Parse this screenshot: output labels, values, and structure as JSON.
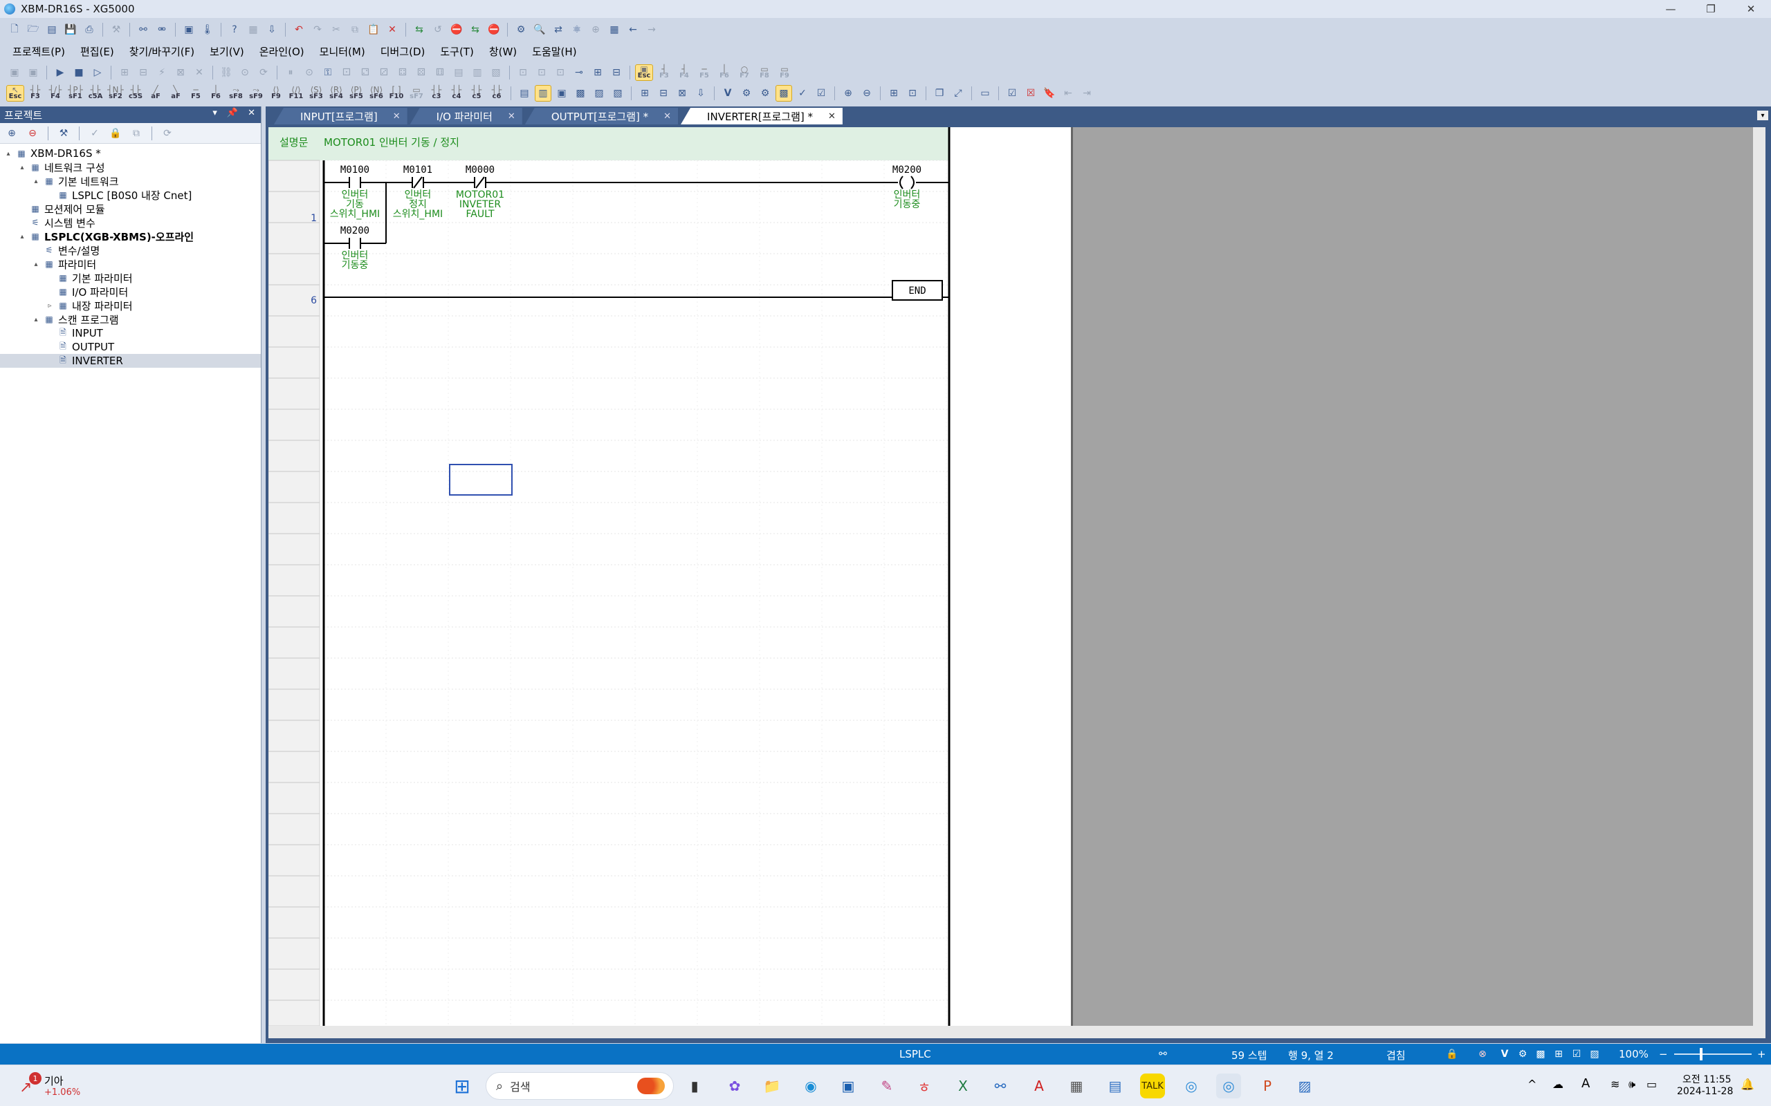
{
  "window": {
    "title": "XBM-DR16S - XG5000"
  },
  "menu": [
    "프로젝트(P)",
    "편집(E)",
    "찾기/바꾸기(F)",
    "보기(V)",
    "온라인(O)",
    "모니터(M)",
    "디버그(D)",
    "도구(T)",
    "창(W)",
    "도움말(H)"
  ],
  "fkeys": [
    "Esc",
    "F3",
    "F4",
    "sF1",
    "c5A",
    "sF2",
    "c5S",
    "aF",
    "aF",
    "F5",
    "F6",
    "sF8",
    "sF9",
    "F9",
    "F11",
    "sF3",
    "sF4",
    "sF5",
    "sF6",
    "F10",
    "sF7",
    "c3",
    "c4",
    "c5",
    "c6"
  ],
  "fkeys2": [
    "F3",
    "F4",
    "F5",
    "F6",
    "F7",
    "F8",
    "F9"
  ],
  "project_panel": {
    "title": "프로젝트",
    "tree": [
      {
        "label": "XBM-DR16S *",
        "level": 0,
        "toggle": "▴",
        "icon": "project-icon",
        "bold": false
      },
      {
        "label": "네트워크 구성",
        "level": 1,
        "toggle": "▴",
        "icon": "network-icon"
      },
      {
        "label": "기본 네트워크",
        "level": 2,
        "toggle": "▴",
        "icon": "network-basic-icon"
      },
      {
        "label": "LSPLC [B0S0 내장 Cnet]",
        "level": 3,
        "toggle": "",
        "icon": "plc-icon"
      },
      {
        "label": "모션제어 모듈",
        "level": 1,
        "toggle": "",
        "icon": "motion-icon"
      },
      {
        "label": "시스템 변수",
        "level": 1,
        "toggle": "",
        "icon": "variable-icon"
      },
      {
        "label": "LSPLC(XGB-XBMS)-오프라인",
        "level": 1,
        "toggle": "▴",
        "icon": "cpu-icon",
        "bold": true
      },
      {
        "label": "변수/설명",
        "level": 2,
        "toggle": "",
        "icon": "variable-icon"
      },
      {
        "label": "파라미터",
        "level": 2,
        "toggle": "▴",
        "icon": "parameter-icon"
      },
      {
        "label": "기본 파라미터",
        "level": 3,
        "toggle": "",
        "icon": "param-page-icon"
      },
      {
        "label": "I/O 파라미터",
        "level": 3,
        "toggle": "",
        "icon": "io-param-icon"
      },
      {
        "label": "내장 파라미터",
        "level": 3,
        "toggle": "▹",
        "icon": "builtin-param-icon"
      },
      {
        "label": "스캔 프로그램",
        "level": 2,
        "toggle": "▴",
        "icon": "scan-icon"
      },
      {
        "label": "INPUT",
        "level": 3,
        "toggle": "",
        "icon": "program-icon"
      },
      {
        "label": "OUTPUT",
        "level": 3,
        "toggle": "",
        "icon": "program-icon"
      },
      {
        "label": "INVERTER",
        "level": 3,
        "toggle": "",
        "icon": "program-icon",
        "selected": true
      }
    ]
  },
  "tabs": [
    {
      "label": "INPUT[프로그램]",
      "active": false
    },
    {
      "label": "I/O 파라미터",
      "active": false
    },
    {
      "label": "OUTPUT[프로그램] *",
      "active": false
    },
    {
      "label": "INVERTER[프로그램] *",
      "active": true
    }
  ],
  "ladder": {
    "comment_tag": "설명문",
    "comment": "MOTOR01 인버터 기동 / 정지",
    "step1": "1",
    "step2": "6",
    "end_label": "END",
    "contacts": [
      {
        "addr": "M0100",
        "desc": [
          "인버터",
          "기동",
          "스위치_HMI"
        ]
      },
      {
        "addr": "M0101",
        "desc": [
          "인버터",
          "정지",
          "스위치_HMI"
        ]
      },
      {
        "addr": "M0000",
        "desc": [
          "MOTOR01",
          "INVETER",
          "FAULT"
        ]
      },
      {
        "addr": "M0200",
        "desc": [
          "인버터",
          "기동중"
        ]
      }
    ],
    "coil": {
      "addr": "M0200",
      "desc": [
        "인버터",
        "기동중"
      ]
    }
  },
  "status": {
    "plc": "LSPLC",
    "steps": "59 스텝",
    "position": "행 9, 열 2",
    "mode": "겹침",
    "zoom": "100%"
  },
  "taskbar": {
    "stock_name": "기아",
    "stock_change": "+1.06%",
    "stock_badge": "1",
    "search_placeholder": "검색",
    "time": "오전 11:55",
    "date": "2024-11-28"
  },
  "colors": {
    "accent": "#0a72c4",
    "ladder_green": "#1c8c1c",
    "comment_bg": "#dff0e3"
  }
}
